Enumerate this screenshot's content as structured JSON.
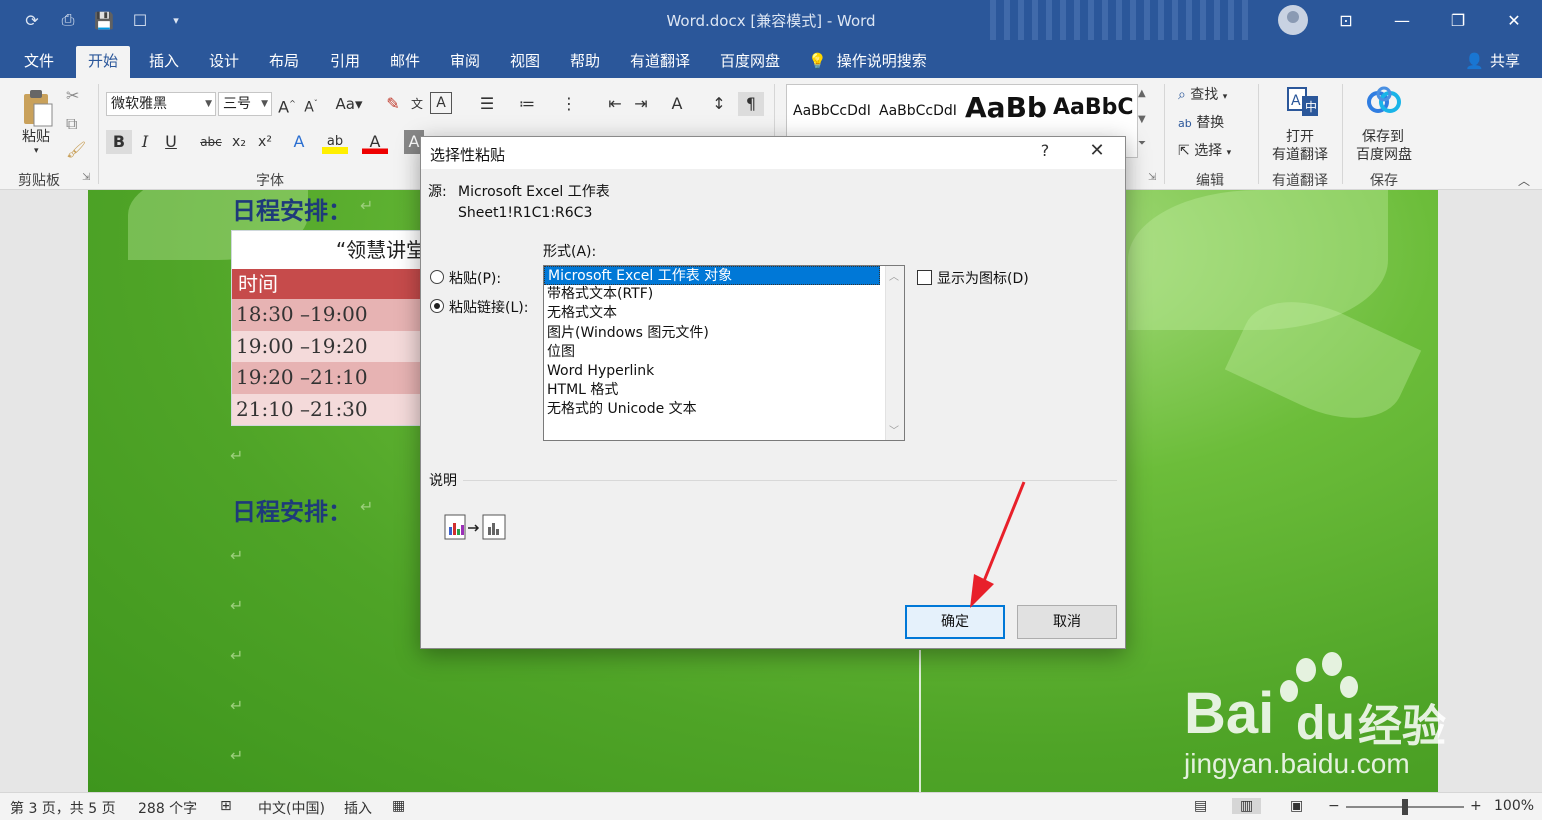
{
  "window": {
    "title": "Word.docx [兼容模式] - Word",
    "share_label": "共享"
  },
  "tabs": [
    {
      "label": "文件"
    },
    {
      "label": "开始"
    },
    {
      "label": "插入"
    },
    {
      "label": "设计"
    },
    {
      "label": "布局"
    },
    {
      "label": "引用"
    },
    {
      "label": "邮件"
    },
    {
      "label": "审阅"
    },
    {
      "label": "视图"
    },
    {
      "label": "帮助"
    },
    {
      "label": "有道翻译"
    },
    {
      "label": "百度网盘"
    }
  ],
  "tell_me": "操作说明搜索",
  "ribbon": {
    "clipboard": {
      "paste_label": "粘贴",
      "group_label": "剪贴板"
    },
    "font": {
      "font_name": "微软雅黑",
      "font_size": "三号",
      "group_label": "字体",
      "aa_label": "Aa"
    },
    "styles": {
      "sample1": "AaBbCcDdI",
      "sample2": "AaBbCcDdI",
      "sample3": "AaBb",
      "sample4": "AaBbC"
    },
    "editing": {
      "find": "查找",
      "replace": "替换",
      "select": "选择",
      "group_label": "编辑"
    },
    "youdao": {
      "open_line1": "打开",
      "open_line2": "有道翻译",
      "group_label": "有道翻译"
    },
    "baidu": {
      "save_line1": "保存到",
      "save_line2": "百度网盘",
      "group_label": "保存"
    }
  },
  "document": {
    "heading1": "日程安排：",
    "heading2": "日程安排：",
    "table_title": "“领慧讲堂",
    "table_header": "时间",
    "rows": [
      "18:30 –19:00",
      "19:00 –19:20",
      "19:20 –21:10",
      "21:10 –21:30"
    ]
  },
  "dialog": {
    "title": "选择性粘贴",
    "help": "?",
    "source_label": "源:",
    "source_value": "Microsoft Excel 工作表",
    "source_range": "Sheet1!R1C1:R6C3",
    "format_label": "形式(A):",
    "paste_option": "粘贴(P):",
    "paste_link_option": "粘贴链接(L):",
    "formats": [
      "Microsoft Excel 工作表 对象",
      "带格式文本(RTF)",
      "无格式文本",
      "图片(Windows 图元文件)",
      "位图",
      "Word Hyperlink",
      "HTML 格式",
      "无格式的 Unicode 文本"
    ],
    "selected_format_index": 0,
    "display_as_icon": "显示为图标(D)",
    "description_label": "说明",
    "ok": "确定",
    "cancel": "取消"
  },
  "status": {
    "page": "第 3 页，共 5 页",
    "words": "288 个字",
    "language": "中文(中国)",
    "mode": "插入",
    "zoom": "100%"
  },
  "watermark": {
    "brand": "Bai",
    "brand2": "经验",
    "url": "jingyan.baidu.com"
  },
  "colors": {
    "word_blue": "#2b579a",
    "accent": "#0078d7",
    "table_header_red": "#c64b4b",
    "heading_blue": "#1e3a7a",
    "arrow_red": "#e8202a"
  }
}
